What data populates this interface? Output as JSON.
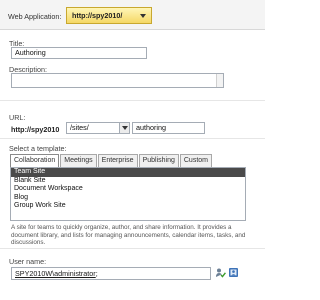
{
  "web_application": {
    "label": "Web Application:",
    "value": "http://spy2010/"
  },
  "title_field": {
    "label": "Title:",
    "value": "Authoring"
  },
  "description_field": {
    "label": "Description:",
    "value": ""
  },
  "url": {
    "label": "URL:",
    "prefix": "http://spy2010",
    "managed_path": "/sites/",
    "site_name": "authoring"
  },
  "template": {
    "label": "Select a template:",
    "tabs": [
      "Collaboration",
      "Meetings",
      "Enterprise",
      "Publishing",
      "Custom"
    ],
    "items": [
      "Team Site",
      "Blank Site",
      "Document Workspace",
      "Blog",
      "Group Work Site"
    ],
    "selected": "Team Site",
    "description": "A site for teams to quickly organize, author, and share information. It provides a document library, and lists for managing announcements, calendar items, tasks, and discussions."
  },
  "user": {
    "label": "User name:",
    "value": "SPY2010W\\administrator",
    "suffix": ";"
  },
  "icons": {
    "check_names": "check-names-icon",
    "browse": "address-book-icon",
    "dropdown": "chevron-down-icon"
  },
  "colors": {
    "accent_yellow": "#f5d866",
    "selected_row": "#4a4a4a"
  }
}
